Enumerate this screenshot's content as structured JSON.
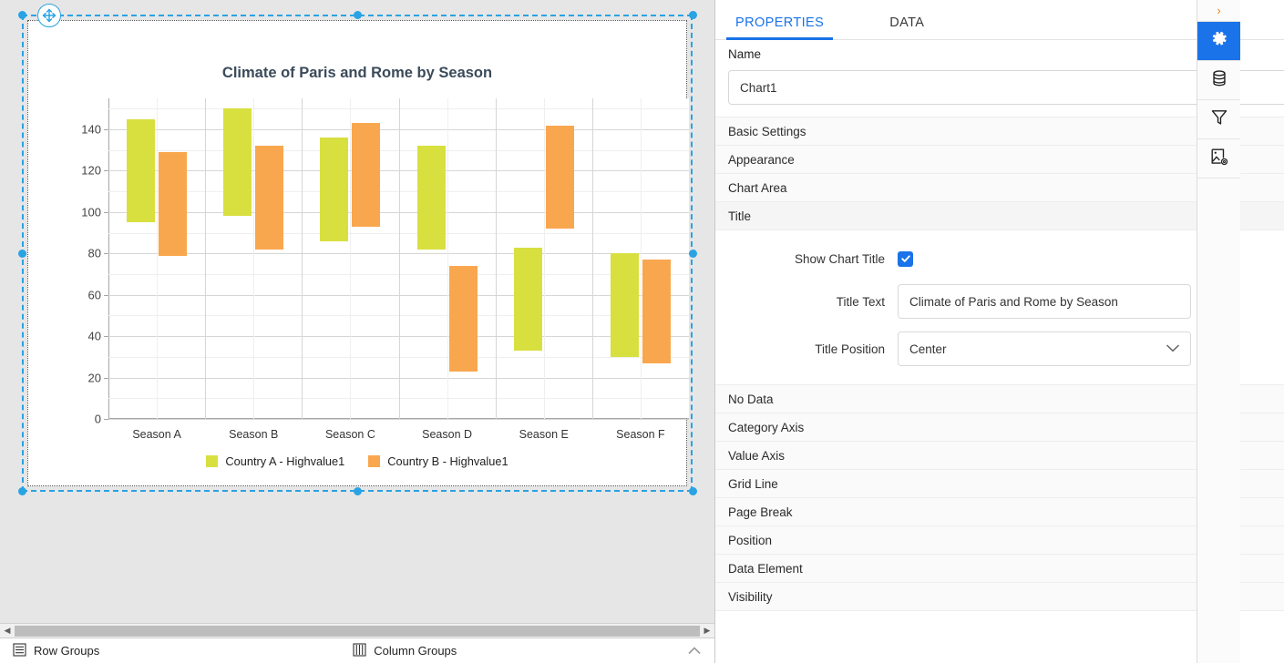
{
  "designer": {
    "chart_name_on_canvas": "Chart1",
    "bottom_bar": {
      "row_groups_label": "Row Groups",
      "column_groups_label": "Column Groups",
      "row_groups_icon": "rows-icon",
      "column_groups_icon": "columns-icon",
      "collapse_icon": "chevron-up-icon"
    },
    "scrollbar": {
      "left_arrow_icon": "triangle-left-icon",
      "right_arrow_icon": "triangle-right-icon"
    },
    "move_handle_icon": "move-cross-icon"
  },
  "chart_data": {
    "type": "bar",
    "subtype": "range-bar",
    "title": "Climate of Paris and Rome by Season",
    "xlabel": "",
    "ylabel": "",
    "ylim": [
      0,
      155
    ],
    "yticks": [
      0,
      20,
      40,
      60,
      80,
      100,
      120,
      140
    ],
    "grid": true,
    "legend_position": "bottom",
    "categories": [
      "Season A",
      "Season B",
      "Season C",
      "Season D",
      "Season E",
      "Season F"
    ],
    "series": [
      {
        "name": "Country A - Highvalue1",
        "color": "#d8e040",
        "low": [
          95,
          98,
          86,
          82,
          33,
          30
        ],
        "high": [
          145,
          150,
          136,
          132,
          83,
          80
        ]
      },
      {
        "name": "Country B - Highvalue1",
        "color": "#f9a74f",
        "low": [
          79,
          82,
          93,
          23,
          92,
          27
        ],
        "high": [
          129,
          132,
          143,
          74,
          142,
          77
        ]
      }
    ],
    "title_color": "#3b4a5a",
    "axis_color": "#a6a6a6",
    "gridline_color": "#d6d6d6"
  },
  "panel": {
    "tabs": [
      {
        "label": "PROPERTIES",
        "active": true
      },
      {
        "label": "DATA",
        "active": false
      }
    ],
    "name_section": {
      "label": "Name",
      "value": "Chart1"
    },
    "accordions": [
      {
        "label": "Basic Settings",
        "sign": "+",
        "open": false
      },
      {
        "label": "Appearance",
        "sign": "+",
        "open": false
      },
      {
        "label": "Chart Area",
        "sign": "+",
        "open": false
      },
      {
        "label": "Title",
        "sign": "−",
        "open": true
      }
    ],
    "title_section": {
      "show_chart_title": {
        "label": "Show Chart Title",
        "checked": true
      },
      "title_text": {
        "label": "Title Text",
        "value": "Climate of Paris and Rome by Season"
      },
      "title_position": {
        "label": "Title Position",
        "value": "Center",
        "caret_icon": "chevron-down-icon"
      }
    },
    "accordions_lower": [
      {
        "label": "No Data",
        "sign": "+"
      },
      {
        "label": "Category Axis",
        "sign": "+"
      },
      {
        "label": "Value Axis",
        "sign": "+"
      },
      {
        "label": "Grid Line",
        "sign": "+"
      },
      {
        "label": "Page Break",
        "sign": "+"
      },
      {
        "label": "Position",
        "sign": "+"
      },
      {
        "label": "Data Element",
        "sign": "+"
      },
      {
        "label": "Visibility",
        "sign": "+"
      }
    ],
    "rail": {
      "expand_icon": "chevron-right-icon",
      "buttons": [
        {
          "icon": "gear-icon",
          "active": true
        },
        {
          "icon": "database-icon",
          "active": false
        },
        {
          "icon": "filter-funnel-icon",
          "active": false
        },
        {
          "icon": "image-settings-icon",
          "active": false
        }
      ]
    },
    "accent_color": "#1a73e8"
  }
}
